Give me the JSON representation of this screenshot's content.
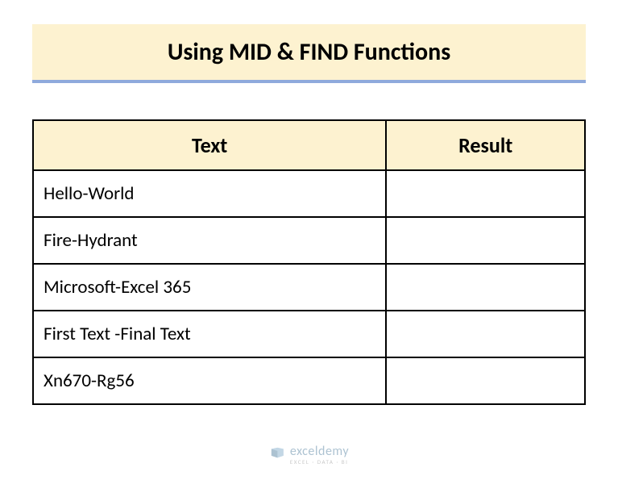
{
  "title": "Using MID & FIND Functions",
  "table": {
    "headers": [
      "Text",
      "Result"
    ],
    "rows": [
      {
        "text": "Hello-World",
        "result": ""
      },
      {
        "text": "Fire-Hydrant",
        "result": ""
      },
      {
        "text": "Microsoft-Excel 365",
        "result": ""
      },
      {
        "text": "First Text -Final Text",
        "result": ""
      },
      {
        "text": "Xn670-Rg56",
        "result": ""
      }
    ]
  },
  "watermark": {
    "brand": "exceldemy",
    "tagline": "EXCEL · DATA · BI"
  }
}
